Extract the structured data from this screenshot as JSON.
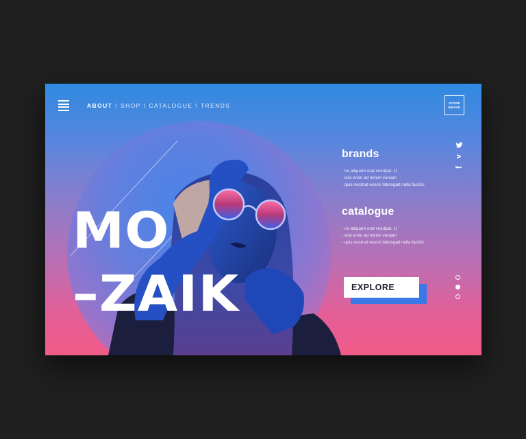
{
  "nav": {
    "items": [
      {
        "label": "ABOUT",
        "active": true
      },
      {
        "label": "SHOP",
        "active": false
      },
      {
        "label": "CATALOGUE",
        "active": false
      },
      {
        "label": "TRENDS",
        "active": false
      }
    ],
    "separator": "\\"
  },
  "logo": {
    "line1": "STORE",
    "line2": "BRAND"
  },
  "hero": {
    "line1": "MO",
    "line2": "–ZAIK"
  },
  "brands": {
    "heading": "brands",
    "bullets": [
      "- no aliquam erat volutpat. U",
      " - wisi enim ad minim veniam",
      " - quis nostrud exerci tationgait nulla facilisi."
    ]
  },
  "catalogue": {
    "heading": "catalogue",
    "bullets": [
      "- no aliquam erat volutpat. U",
      " - wisi enim ad minim veniam",
      " - quis nostrud exerci tationgait nulla facilisi."
    ]
  },
  "cta": {
    "label": "EXPLORE"
  },
  "social": [
    {
      "icon": "twitter-icon",
      "glyph": ""
    },
    {
      "icon": "vimeo-icon",
      "glyph": "v"
    },
    {
      "icon": "facebook-icon",
      "glyph": "f"
    }
  ],
  "slider": {
    "count": 3,
    "active_index": 1
  },
  "colors": {
    "accent": "#3a78e8",
    "gradient_top": "#2f8ae0",
    "gradient_bottom": "#f05b88"
  }
}
